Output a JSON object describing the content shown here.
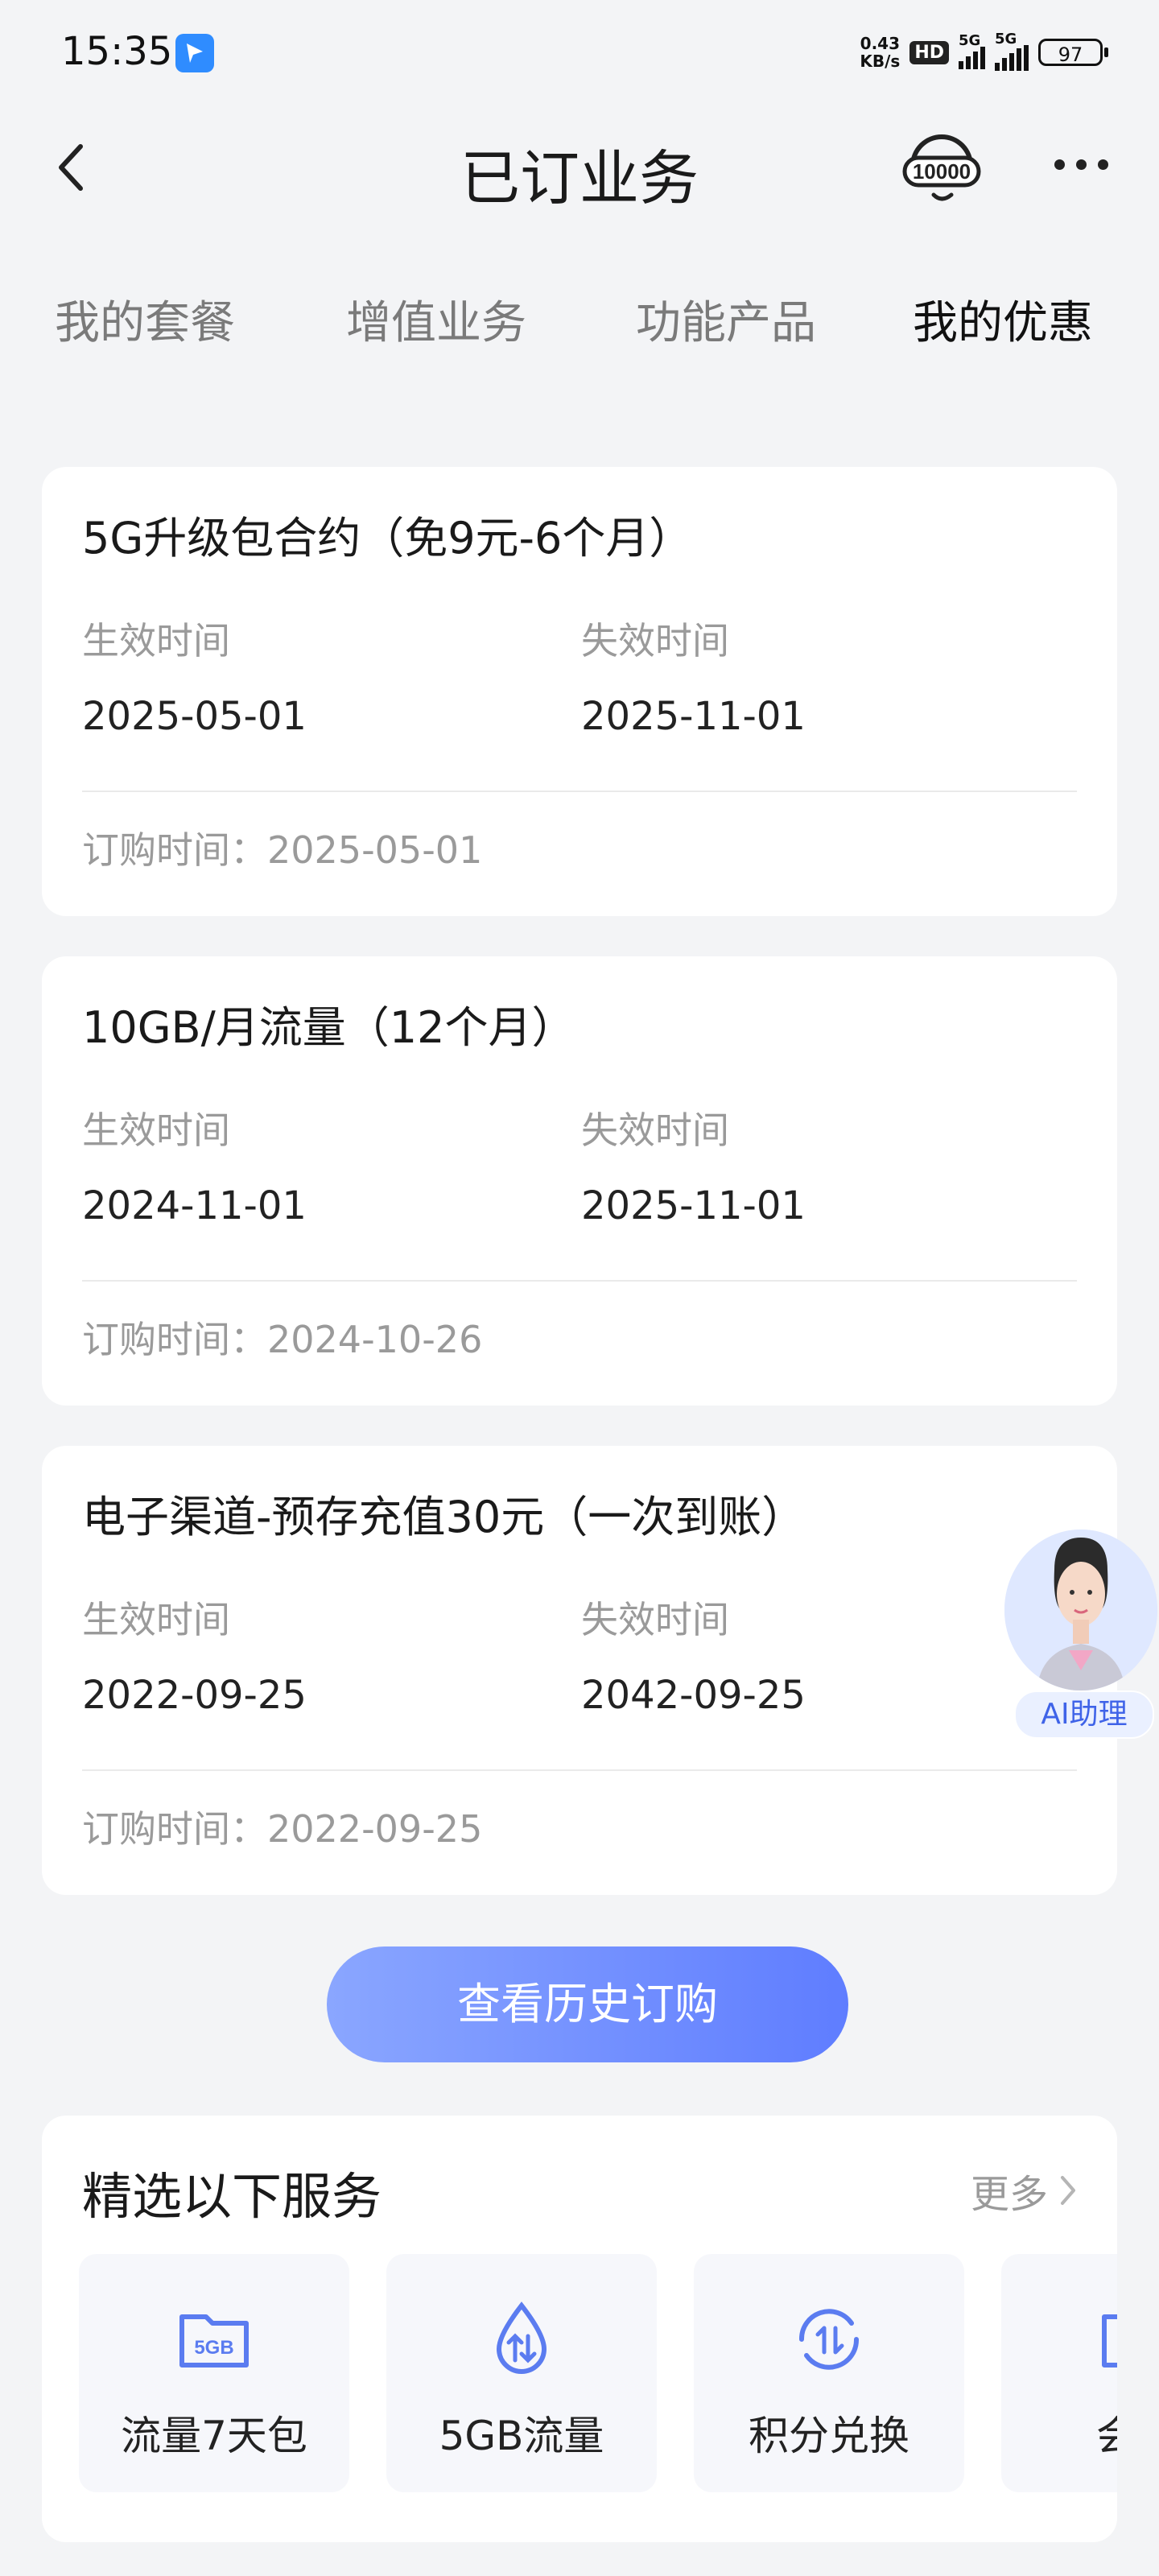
{
  "status_bar": {
    "time": "15:35",
    "speed_value": "0.43",
    "speed_unit": "KB/s",
    "hd": "HD",
    "net1": "5G",
    "net2": "5G",
    "battery": "97"
  },
  "header": {
    "title": "已订业务",
    "back_icon": "chevron-left-icon",
    "service_icon_text": "10000",
    "more_icon": "more-dots-icon"
  },
  "tabs": [
    {
      "label": "我的套餐",
      "active": false
    },
    {
      "label": "增值业务",
      "active": false
    },
    {
      "label": "功能产品",
      "active": false
    },
    {
      "label": "我的优惠",
      "active": true
    }
  ],
  "offers": [
    {
      "title": "5G升级包合约（免9元-6个月）",
      "start_label": "生效时间",
      "start": "2025-05-01",
      "end_label": "失效时间",
      "end": "2025-11-01",
      "order": "订购时间：2025-05-01"
    },
    {
      "title": "10GB/月流量（12个月）",
      "start_label": "生效时间",
      "start": "2024-11-01",
      "end_label": "失效时间",
      "end": "2025-11-01",
      "order": "订购时间：2024-10-26"
    },
    {
      "title": "电子渠道-预存充值30元（一次到账）",
      "start_label": "生效时间",
      "start": "2022-09-25",
      "end_label": "失效时间",
      "end": "2042-09-25",
      "order": "订购时间：2022-09-25"
    }
  ],
  "history_button": "查看历史订购",
  "ai_assistant": {
    "label": "AI助理"
  },
  "services": {
    "title": "精选以下服务",
    "more": "更多",
    "items": [
      {
        "label": "流量7天包",
        "icon": "data-pack-icon",
        "badge": "5GB"
      },
      {
        "label": "5GB流量",
        "icon": "data-drop-icon"
      },
      {
        "label": "积分兑换",
        "icon": "points-exchange-icon"
      },
      {
        "label": "会员",
        "icon": "membership-icon"
      }
    ]
  },
  "colors": {
    "accent_start": "#8aa6ff",
    "accent_end": "#5f7dff",
    "background": "#f3f4f6",
    "icon": "#5b7cf0"
  }
}
